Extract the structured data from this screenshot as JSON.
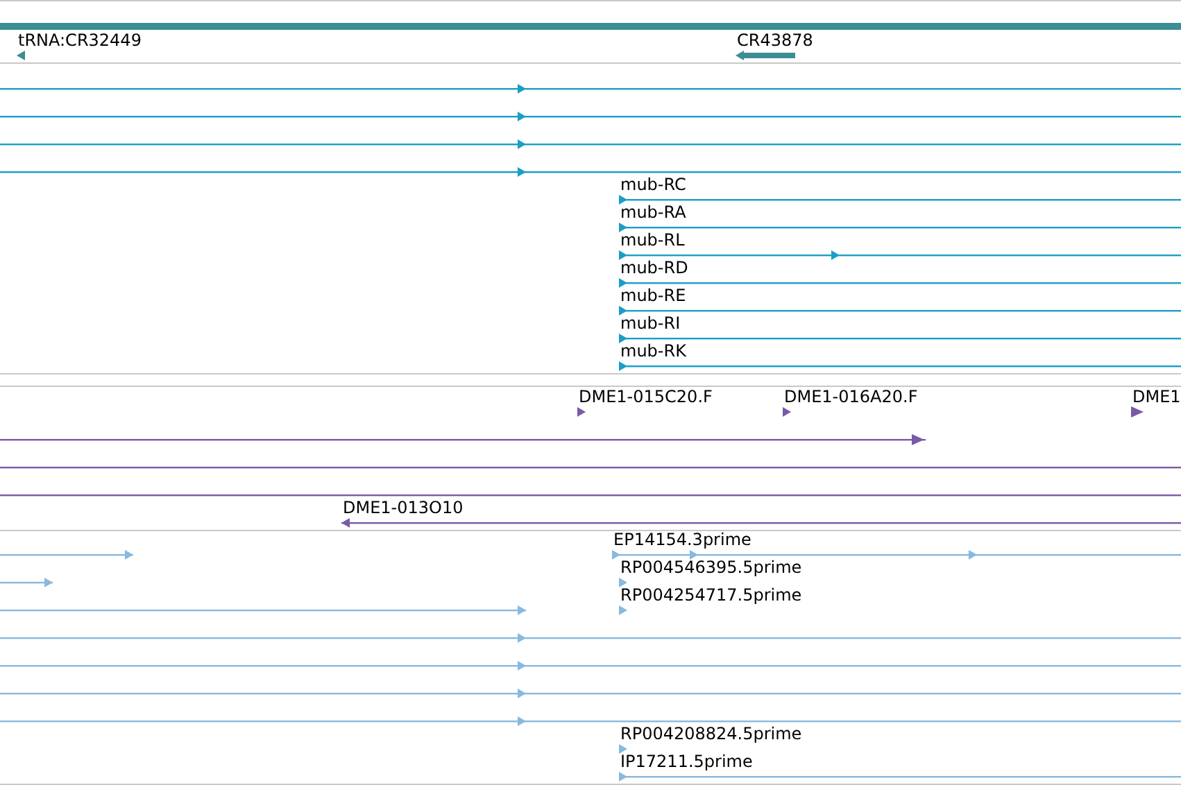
{
  "tracks": [
    {
      "color": "#3a8e94",
      "features": [
        {
          "kind": "bar"
        },
        {
          "kind": "marker",
          "label": "tRNA:CR32449",
          "reverse": true
        },
        {
          "kind": "bar",
          "label": "CR43878",
          "reverse": true
        }
      ]
    },
    {
      "color": "#1a9ec6",
      "features": [
        {
          "kind": "line",
          "reverse": false
        },
        {
          "kind": "line",
          "reverse": false
        },
        {
          "kind": "line",
          "reverse": false
        },
        {
          "kind": "line",
          "reverse": false
        },
        {
          "kind": "line",
          "label": "mub-RC",
          "reverse": false
        },
        {
          "kind": "line",
          "label": "mub-RA",
          "reverse": false
        },
        {
          "kind": "line",
          "label": "mub-RL",
          "reverse": false
        },
        {
          "kind": "line",
          "label": "mub-RD",
          "reverse": false
        },
        {
          "kind": "line",
          "label": "mub-RE",
          "reverse": false
        },
        {
          "kind": "line",
          "label": "mub-RI",
          "reverse": false
        },
        {
          "kind": "line",
          "label": "mub-RK",
          "reverse": false
        }
      ]
    },
    {
      "color": "#7a5aa8",
      "features": [
        {
          "kind": "marker",
          "label": "DME1-015C20.F",
          "reverse": false
        },
        {
          "kind": "marker",
          "label": "DME1-016A20.F",
          "reverse": false
        },
        {
          "kind": "marker",
          "label": "DME1",
          "reverse": false
        },
        {
          "kind": "line",
          "reverse": false
        },
        {
          "kind": "line"
        },
        {
          "kind": "line"
        },
        {
          "kind": "line",
          "label": "DME1-013O10",
          "reverse": true
        }
      ]
    },
    {
      "color": "#88b9de",
      "features": [
        {
          "kind": "line",
          "reverse": false
        },
        {
          "kind": "line",
          "label": "EP14154.3prime",
          "reverse": false
        },
        {
          "kind": "line",
          "reverse": false
        },
        {
          "kind": "marker",
          "label": "RP004546395.5prime",
          "reverse": false
        },
        {
          "kind": "line",
          "reverse": false
        },
        {
          "kind": "marker",
          "label": "RP004254717.5prime",
          "reverse": false
        },
        {
          "kind": "line",
          "reverse": false
        },
        {
          "kind": "line",
          "reverse": false
        },
        {
          "kind": "line",
          "reverse": false
        },
        {
          "kind": "line",
          "reverse": false
        },
        {
          "kind": "marker",
          "label": "RP004208824.5prime",
          "reverse": false
        },
        {
          "kind": "line",
          "label": "IP17211.5prime",
          "reverse": false
        }
      ]
    }
  ]
}
